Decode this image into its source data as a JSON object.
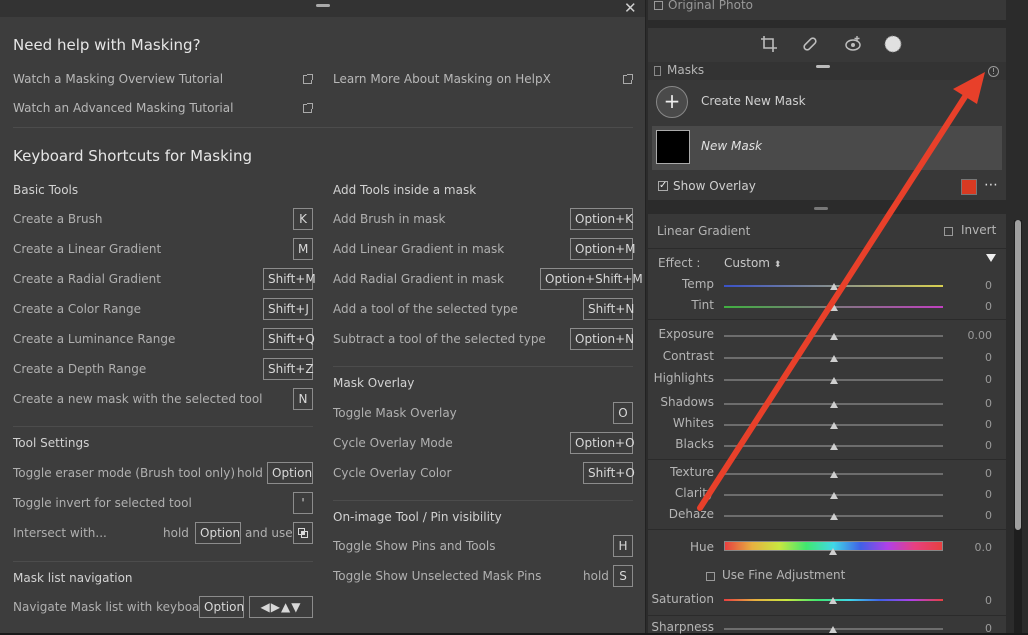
{
  "help": {
    "title": "Need help with Masking?",
    "links": [
      "Watch a Masking Overview Tutorial",
      "Watch an Advanced Masking Tutorial",
      "Learn More About Masking on HelpX"
    ],
    "shortcuts_title": "Keyboard Shortcuts for Masking",
    "basic_tools": {
      "title": "Basic Tools",
      "items": [
        {
          "label": "Create a Brush",
          "key": "K"
        },
        {
          "label": "Create a Linear Gradient",
          "key": "M"
        },
        {
          "label": "Create a Radial Gradient",
          "key": "Shift+M"
        },
        {
          "label": "Create a Color Range",
          "key": "Shift+J"
        },
        {
          "label": "Create a Luminance Range",
          "key": "Shift+Q"
        },
        {
          "label": "Create a Depth Range",
          "key": "Shift+Z"
        },
        {
          "label": "Create a new mask with the selected tool",
          "key": "N"
        }
      ]
    },
    "tool_settings": {
      "title": "Tool Settings",
      "eraser": {
        "label": "Toggle eraser mode (Brush tool only)",
        "hold": "hold",
        "key": "Option"
      },
      "invert": {
        "label": "Toggle invert for selected tool",
        "key": "'"
      },
      "intersect": {
        "label": "Intersect with...",
        "hold": "hold",
        "key": "Option",
        "and_use": "and use"
      }
    },
    "mask_list": {
      "title": "Mask list navigation",
      "label": "Navigate Mask list with keyboard",
      "key": "Option",
      "arrows": "◀▶▲▼"
    },
    "add_tools": {
      "title": "Add Tools inside a mask",
      "items": [
        {
          "label": "Add Brush in mask",
          "key": "Option+K"
        },
        {
          "label": "Add Linear Gradient in mask",
          "key": "Option+M"
        },
        {
          "label": "Add Radial Gradient in mask",
          "key": "Option+Shift+M"
        },
        {
          "label": "Add a tool of the selected type",
          "key": "Shift+N"
        },
        {
          "label": "Subtract a tool of the selected type",
          "key": "Option+N"
        }
      ]
    },
    "mask_overlay": {
      "title": "Mask Overlay",
      "items": [
        {
          "label": "Toggle Mask Overlay",
          "key": "O"
        },
        {
          "label": "Cycle Overlay Mode",
          "key": "Option+O"
        },
        {
          "label": "Cycle Overlay Color",
          "key": "Shift+O"
        }
      ]
    },
    "pins": {
      "title": "On-image Tool / Pin visibility",
      "show_pins": {
        "label": "Toggle Show Pins and Tools",
        "key": "H"
      },
      "unselected": {
        "label": "Toggle Show Unselected Mask Pins",
        "hold": "hold",
        "key": "S"
      }
    }
  },
  "panel": {
    "original_photo": "Original Photo",
    "masks_title": "Masks",
    "create_new_mask": "Create New Mask",
    "new_mask": "New Mask",
    "show_overlay": "Show Overlay",
    "overlay_color": "#d83a22",
    "linear_gradient": "Linear Gradient",
    "invert": "Invert",
    "effect_label": "Effect :",
    "effect_value": "Custom",
    "sliders": [
      {
        "label": "Temp",
        "value": "0",
        "pos": 0.5,
        "track": "temp"
      },
      {
        "label": "Tint",
        "value": "0",
        "pos": 0.5,
        "track": "tint"
      },
      {
        "label": "Exposure",
        "value": "0.00",
        "pos": 0.5
      },
      {
        "label": "Contrast",
        "value": "0",
        "pos": 0.5
      },
      {
        "label": "Highlights",
        "value": "0",
        "pos": 0.5
      },
      {
        "label": "Shadows",
        "value": "0",
        "pos": 0.5
      },
      {
        "label": "Whites",
        "value": "0",
        "pos": 0.5
      },
      {
        "label": "Blacks",
        "value": "0",
        "pos": 0.5
      },
      {
        "label": "Texture",
        "value": "0",
        "pos": 0.5
      },
      {
        "label": "Clarity",
        "value": "0",
        "pos": 0.5
      },
      {
        "label": "Dehaze",
        "value": "0",
        "pos": 0.5
      }
    ],
    "hue": {
      "label": "Hue",
      "value": "0.0"
    },
    "fine_adjustment": "Use Fine Adjustment",
    "saturation": {
      "label": "Saturation",
      "value": "0"
    },
    "sharpness": {
      "label": "Sharpness",
      "value": "0"
    }
  },
  "annotation_color": "#e8402a"
}
